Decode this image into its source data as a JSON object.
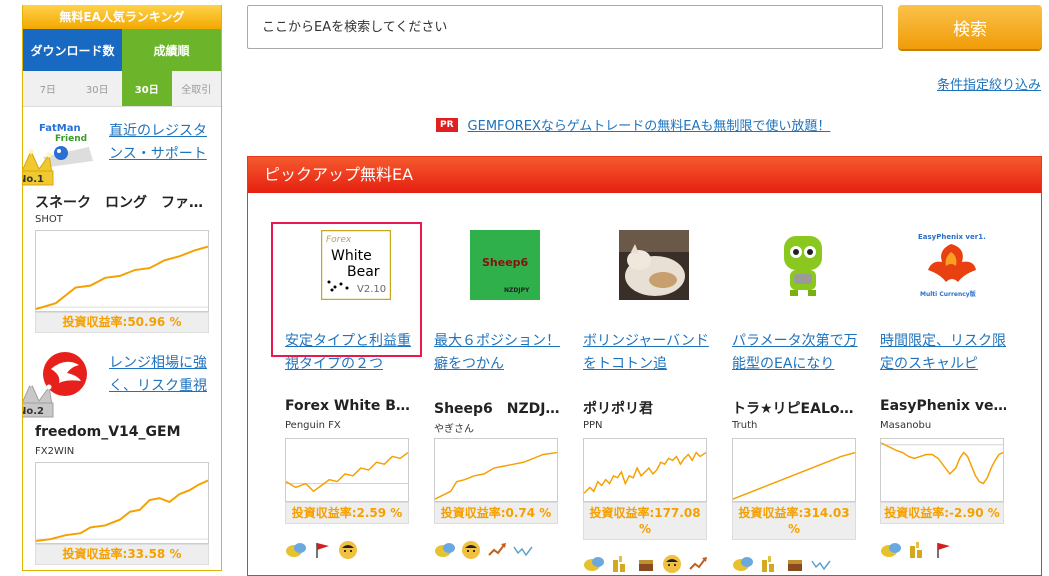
{
  "sidebar": {
    "title": "無料EA人気ランキング",
    "tabs": [
      "ダウンロード数",
      "成績順"
    ],
    "periods": [
      "7日",
      "30日",
      "30日",
      "全取引"
    ],
    "ranks": [
      {
        "badge": "No.1",
        "link": "直近のレジスタンス・サポート",
        "name": "スネーク　ロング　ファ…",
        "author": "SHOT",
        "roi": "投資収益率:50.96 %"
      },
      {
        "badge": "No.2",
        "link": "レンジ相場に強く、リスク重視",
        "name": "freedom_V14_GEM",
        "author": "FX2WIN",
        "roi": "投資収益率:33.58 %"
      }
    ]
  },
  "search": {
    "placeholder": "ここからEAを検索してください",
    "button": "検索",
    "filter_link": "条件指定絞り込み"
  },
  "pr": {
    "badge": "PR",
    "text": "GEMFOREXならゲムトレードの無料EAも無制限で使い放題！"
  },
  "pickup": {
    "title": "ピックアップ無料EA",
    "cards": [
      {
        "thumb_top": "Forex",
        "thumb_main1": "White",
        "thumb_main2": "Bear",
        "thumb_ver": "V2.10",
        "link": "安定タイプと利益重視タイプの２つ",
        "name": "Forex White B…",
        "author": "Penguin FX",
        "roi": "投資収益率:2.59 %"
      },
      {
        "thumb_text": "Sheep6",
        "thumb_sub": "NZDJPY",
        "link": "最大６ポジション！癖をつかん",
        "name": "Sheep6　NZDJ…",
        "author": "やぎさん",
        "roi": "投資収益率:0.74 %"
      },
      {
        "link": "ボリンジャーバンドをトコトン追",
        "name": "ポリポリ君",
        "author": "PPN",
        "roi": "投資収益率:177.08 %"
      },
      {
        "link": "パラメータ次第で万能型のEAになり",
        "name": "トラ★リピEALo…",
        "author": "Truth",
        "roi": "投資収益率:314.03 %"
      },
      {
        "thumb_text": "EasyPhenix ver1.1",
        "thumb_sub": "Multi Currency版",
        "link": "時間限定、リスク限定のスキャルピ",
        "name": "EasyPhenix ve…",
        "author": "Masanobu",
        "roi": "投資収益率:-2.90 %"
      }
    ]
  },
  "colors": {
    "accent_orange": "#f5a000",
    "link_blue": "#1e73be",
    "pickup_red": "#e52010",
    "tab_blue": "#1869c2",
    "tab_green": "#6cb52a"
  }
}
